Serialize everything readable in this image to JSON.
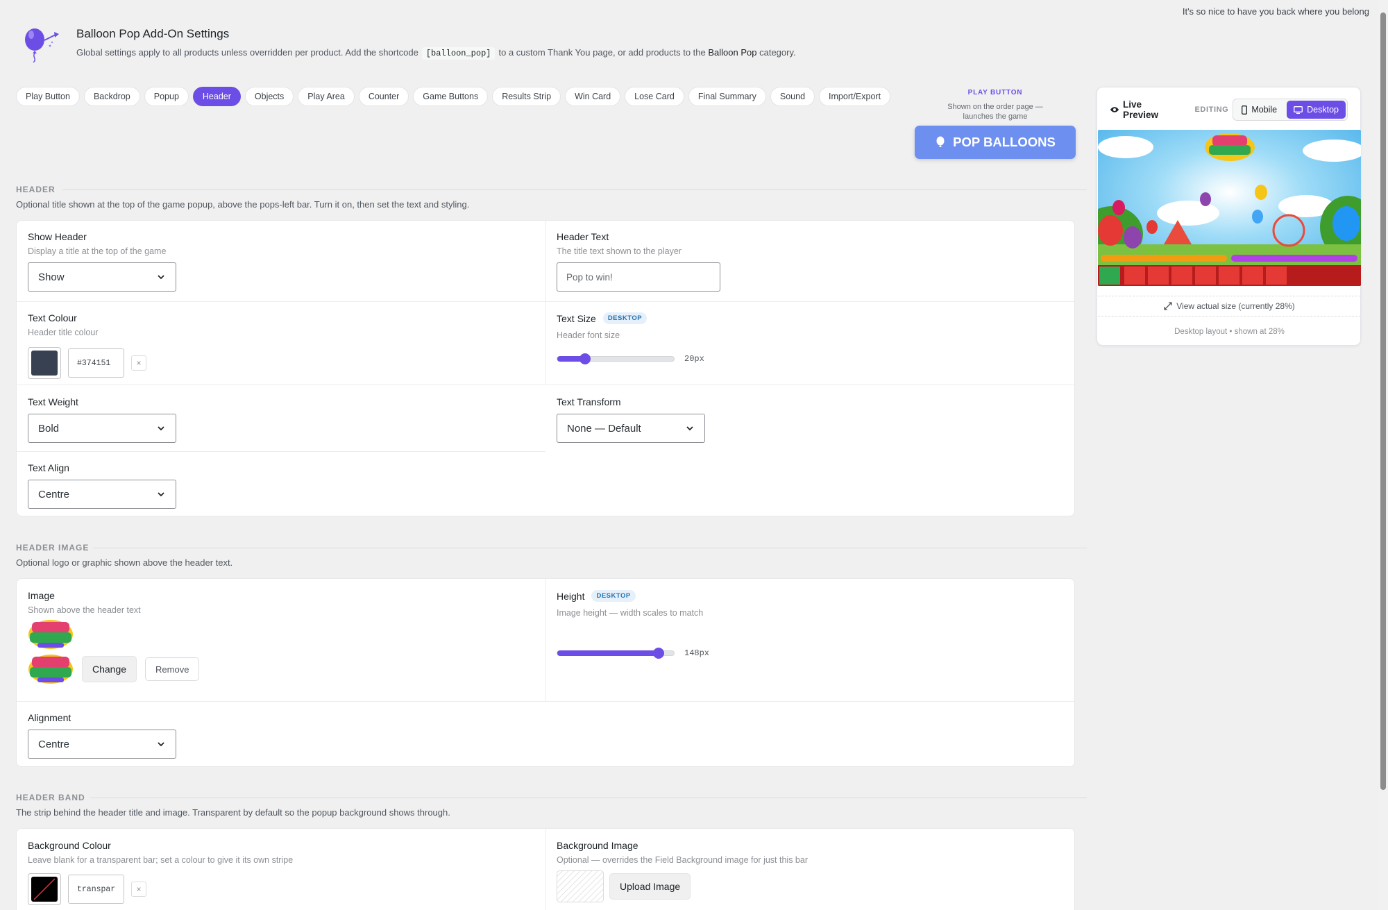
{
  "top_note": "It's so nice to have you back where you belong",
  "header": {
    "title": "Balloon Pop Add-On Settings",
    "desc_pre": "Global settings apply to all products unless overridden per product. Add the shortcode",
    "shortcode": "[balloon_pop]",
    "desc_mid": "to a custom Thank You page, or add products to the",
    "category": "Balloon Pop",
    "desc_post": "category."
  },
  "tabs": [
    "Play Button",
    "Backdrop",
    "Popup",
    "Header",
    "Objects",
    "Play Area",
    "Counter",
    "Game Buttons",
    "Results Strip",
    "Win Card",
    "Lose Card",
    "Final Summary",
    "Sound",
    "Import/Export"
  ],
  "active_tab": "Header",
  "play_button": {
    "label": "PLAY BUTTON",
    "sub": "Shown on the order page — launches the game",
    "text": "POP BALLOONS"
  },
  "sections": {
    "header": {
      "title": "HEADER",
      "desc": "Optional title shown at the top of the game popup, above the pops-left bar. Turn it on, then set the text and styling.",
      "show_header": {
        "label": "Show Header",
        "desc": "Display a title at the top of the game",
        "value": "Show"
      },
      "header_text": {
        "label": "Header Text",
        "desc": "The title text shown to the player",
        "value": "Pop to win!"
      },
      "text_colour": {
        "label": "Text Colour",
        "desc": "Header title colour",
        "value": "#374151",
        "color": "#374151"
      },
      "text_size": {
        "label": "Text Size",
        "badge": "DESKTOP",
        "desc": "Header font size",
        "value": "20px",
        "fraction": 0.24
      },
      "text_weight": {
        "label": "Text Weight",
        "value": "Bold"
      },
      "text_transform": {
        "label": "Text Transform",
        "value": "None — Default"
      },
      "text_align": {
        "label": "Text Align",
        "value": "Centre"
      }
    },
    "header_image": {
      "title": "HEADER IMAGE",
      "desc": "Optional logo or graphic shown above the header text.",
      "image": {
        "label": "Image",
        "desc": "Shown above the header text",
        "change": "Change",
        "remove": "Remove"
      },
      "height": {
        "label": "Height",
        "badge": "DESKTOP",
        "desc": "Image height — width scales to match",
        "value": "148px",
        "fraction": 0.87
      },
      "alignment": {
        "label": "Alignment",
        "value": "Centre"
      }
    },
    "header_band": {
      "title": "HEADER BAND",
      "desc": "The strip behind the header title and image. Transparent by default so the popup background shows through.",
      "bg_colour": {
        "label": "Background Colour",
        "desc": "Leave blank for a transparent bar; set a colour to give it its own stripe",
        "value": "transpar"
      },
      "bg_image": {
        "label": "Background Image",
        "desc": "Optional — overrides the Field Background image for just this bar",
        "button": "Upload Image"
      }
    }
  },
  "preview": {
    "title": "Live Preview",
    "editing": "EDITING",
    "mobile": "Mobile",
    "desktop": "Desktop",
    "view_actual": "View actual size (currently 28%)",
    "footer": "Desktop layout • shown at 28%"
  },
  "colors": {
    "accent": "#6c4ee6",
    "play_button": "#6c8ff0"
  }
}
